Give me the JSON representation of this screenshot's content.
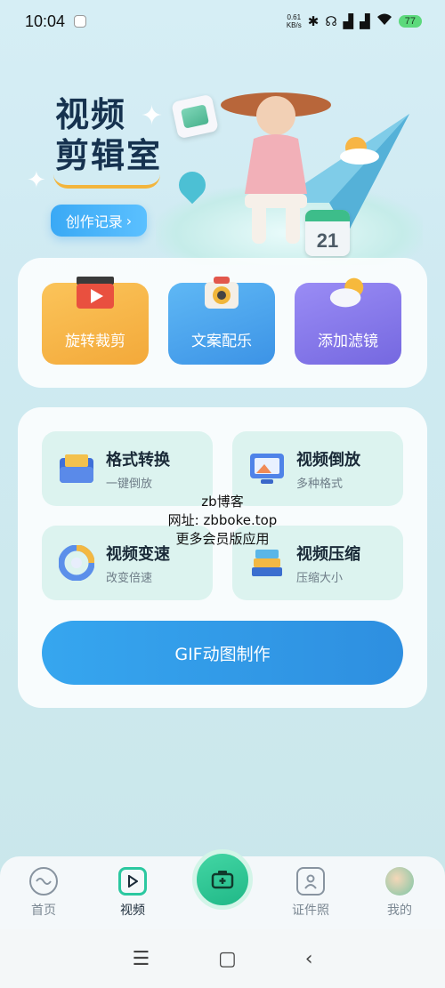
{
  "status_bar": {
    "time": "10:04",
    "net_speed_value": "0.61",
    "net_speed_unit": "KB/s",
    "battery": "77"
  },
  "hero": {
    "title": "视频\n剪辑室",
    "button_label": "创作记录",
    "calendar_day": "21"
  },
  "quick_features": [
    {
      "label": "旋转裁剪",
      "icon": "clapperboard-icon"
    },
    {
      "label": "文案配乐",
      "icon": "camera-icon"
    },
    {
      "label": "添加滤镜",
      "icon": "weather-cloud-icon"
    }
  ],
  "tools": [
    {
      "title": "格式转换",
      "subtitle": "一键倒放",
      "icon": "folder-icon"
    },
    {
      "title": "视频倒放",
      "subtitle": "多种格式",
      "icon": "picture-monitor-icon"
    },
    {
      "title": "视频变速",
      "subtitle": "改变倍速",
      "icon": "speed-dial-icon"
    },
    {
      "title": "视频压缩",
      "subtitle": "压缩大小",
      "icon": "stack-layers-icon"
    }
  ],
  "gif_button_label": "GIF动图制作",
  "watermark": {
    "line1": "zb博客",
    "line2": "网址: zbboke.top",
    "line3": "更多会员版应用"
  },
  "bottom_nav": {
    "home": "首页",
    "video": "视频",
    "id_photo": "证件照",
    "mine": "我的",
    "active": "video"
  },
  "colors": {
    "accent_blue": "#2e8fe0",
    "accent_green": "#20b887",
    "tile_orange": "#f3a93a",
    "tile_blue": "#3c93e6",
    "tile_purple": "#7568e0"
  }
}
